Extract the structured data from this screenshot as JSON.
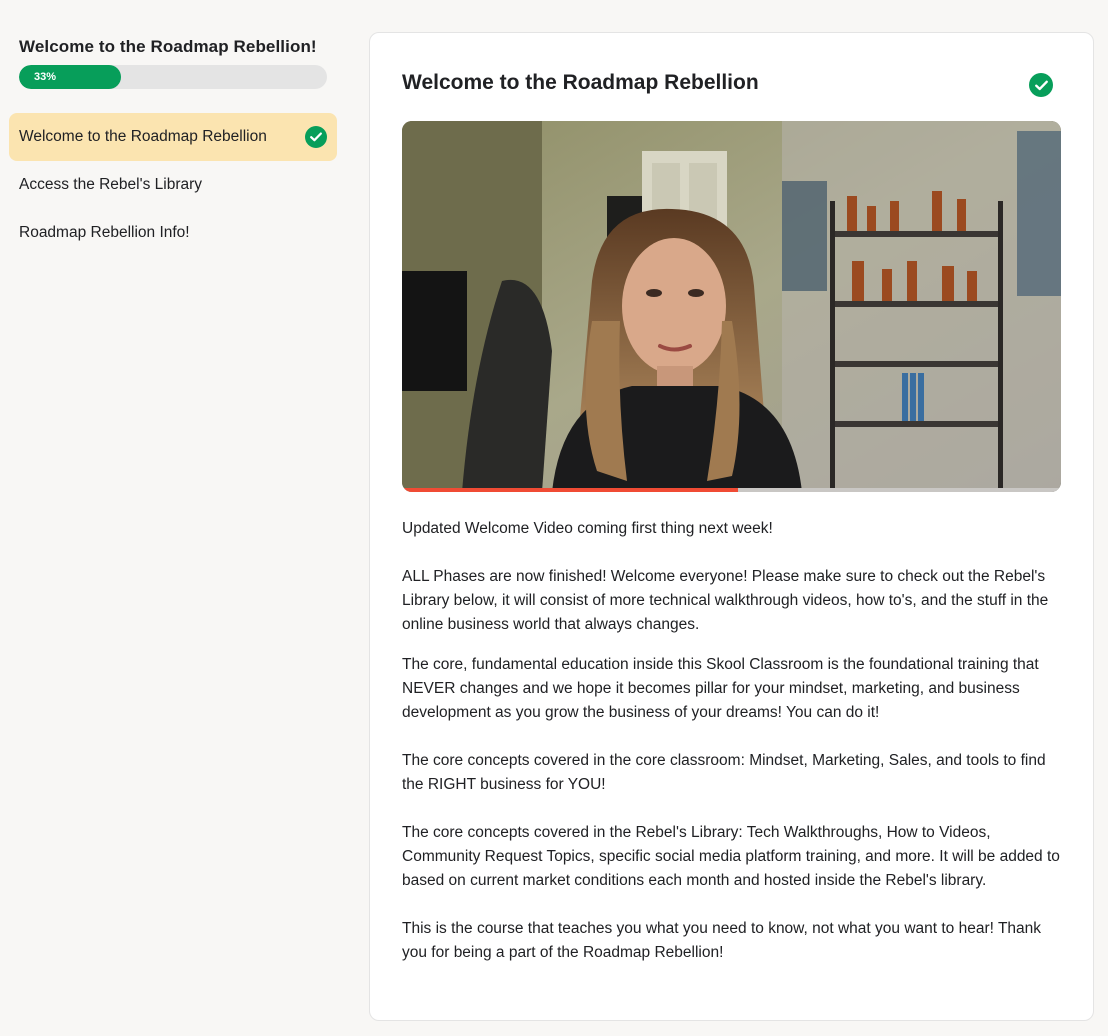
{
  "sidebar": {
    "course_title": "Welcome to the Roadmap Rebellion!",
    "progress_label": "33%",
    "progress_value": 0.33,
    "lessons": [
      {
        "label": "Welcome to the Roadmap Rebellion",
        "completed": true,
        "active": true
      },
      {
        "label": "Access the Rebel's Library",
        "completed": false,
        "active": false
      },
      {
        "label": "Roadmap Rebellion Info!",
        "completed": false,
        "active": false
      }
    ]
  },
  "lesson": {
    "title": "Welcome to the Roadmap Rebellion",
    "completed": true,
    "video_progress": 0.51,
    "paragraphs": [
      "Updated Welcome Video coming first thing next week!",
      "ALL Phases are now finished! Welcome everyone! Please make sure to check out the Rebel's Library below, it will consist of more technical walkthrough videos, how to's, and the stuff in the online business world that always changes.",
      "The core, fundamental education inside this Skool Classroom is the foundational training that NEVER changes and we hope it becomes pillar for your mindset, marketing, and business development as you grow the business of your dreams! You can do it!",
      "The core concepts covered in the core classroom: Mindset, Marketing, Sales, and tools to find the RIGHT business for YOU!",
      "The core concepts covered in the Rebel's Library: Tech Walkthroughs, How to Videos, Community Request Topics, specific social media platform training, and more. It will be added to based on current market conditions each month and hosted inside the Rebel's library.",
      "This is the course that teaches you what you need to know, not what you want to hear! Thank you for being a part of the Roadmap Rebellion!"
    ]
  },
  "colors": {
    "accent_green": "#079e5a",
    "active_lesson_bg": "#fbe4b0",
    "video_progress": "#f04b34"
  },
  "icons": {
    "completed": "check-circle-icon"
  }
}
